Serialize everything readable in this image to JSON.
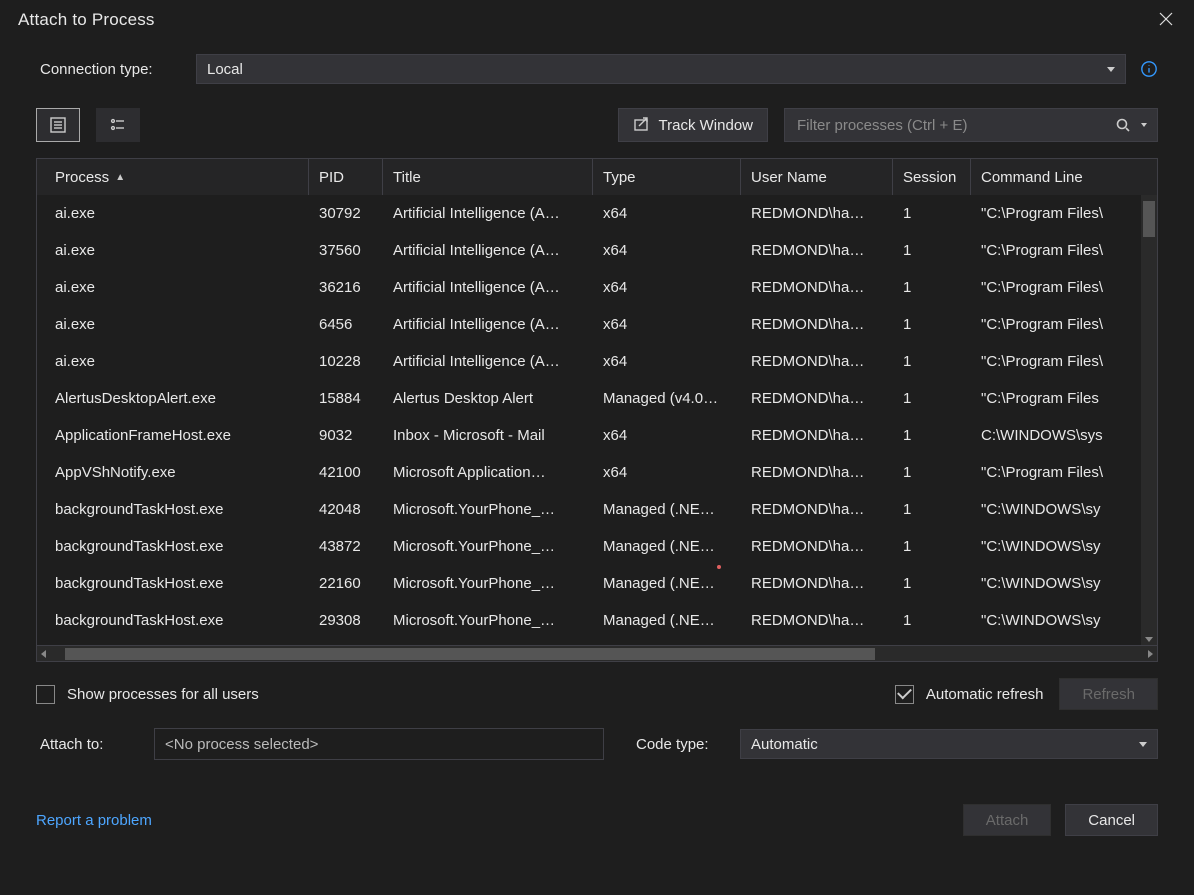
{
  "dialog": {
    "title": "Attach to Process"
  },
  "connection": {
    "label": "Connection type:",
    "value": "Local"
  },
  "toolbar": {
    "track_window_label": "Track Window",
    "filter_placeholder": "Filter processes (Ctrl + E)"
  },
  "columns": {
    "process": "Process",
    "pid": "PID",
    "title": "Title",
    "type": "Type",
    "user": "User Name",
    "session": "Session",
    "cmd": "Command Line"
  },
  "processes": [
    {
      "name": "ai.exe",
      "pid": "30792",
      "title": "Artificial Intelligence (A…",
      "type": "x64",
      "user": "REDMOND\\ha…",
      "session": "1",
      "cmd": "\"C:\\Program Files\\"
    },
    {
      "name": "ai.exe",
      "pid": "37560",
      "title": "Artificial Intelligence (A…",
      "type": "x64",
      "user": "REDMOND\\ha…",
      "session": "1",
      "cmd": "\"C:\\Program Files\\"
    },
    {
      "name": "ai.exe",
      "pid": "36216",
      "title": "Artificial Intelligence (A…",
      "type": "x64",
      "user": "REDMOND\\ha…",
      "session": "1",
      "cmd": "\"C:\\Program Files\\"
    },
    {
      "name": "ai.exe",
      "pid": "6456",
      "title": "Artificial Intelligence (A…",
      "type": "x64",
      "user": "REDMOND\\ha…",
      "session": "1",
      "cmd": "\"C:\\Program Files\\"
    },
    {
      "name": "ai.exe",
      "pid": "10228",
      "title": "Artificial Intelligence (A…",
      "type": "x64",
      "user": "REDMOND\\ha…",
      "session": "1",
      "cmd": "\"C:\\Program Files\\"
    },
    {
      "name": "AlertusDesktopAlert.exe",
      "pid": "15884",
      "title": "Alertus Desktop Alert",
      "type": "Managed (v4.0…",
      "user": "REDMOND\\ha…",
      "session": "1",
      "cmd": "\"C:\\Program Files"
    },
    {
      "name": "ApplicationFrameHost.exe",
      "pid": "9032",
      "title": "Inbox - Microsoft - Mail",
      "type": "x64",
      "user": "REDMOND\\ha…",
      "session": "1",
      "cmd": "C:\\WINDOWS\\sys"
    },
    {
      "name": "AppVShNotify.exe",
      "pid": "42100",
      "title": "Microsoft Application…",
      "type": "x64",
      "user": "REDMOND\\ha…",
      "session": "1",
      "cmd": "\"C:\\Program Files\\"
    },
    {
      "name": "backgroundTaskHost.exe",
      "pid": "42048",
      "title": "Microsoft.YourPhone_…",
      "type": "Managed (.NE…",
      "user": "REDMOND\\ha…",
      "session": "1",
      "cmd": "\"C:\\WINDOWS\\sy"
    },
    {
      "name": "backgroundTaskHost.exe",
      "pid": "43872",
      "title": "Microsoft.YourPhone_…",
      "type": "Managed (.NE…",
      "user": "REDMOND\\ha…",
      "session": "1",
      "cmd": "\"C:\\WINDOWS\\sy"
    },
    {
      "name": "backgroundTaskHost.exe",
      "pid": "22160",
      "title": "Microsoft.YourPhone_…",
      "type": "Managed (.NE…",
      "user": "REDMOND\\ha…",
      "session": "1",
      "cmd": "\"C:\\WINDOWS\\sy"
    },
    {
      "name": "backgroundTaskHost.exe",
      "pid": "29308",
      "title": "Microsoft.YourPhone_…",
      "type": "Managed (.NE…",
      "user": "REDMOND\\ha…",
      "session": "1",
      "cmd": "\"C:\\WINDOWS\\sy"
    }
  ],
  "options": {
    "show_all_users_label": "Show processes for all users",
    "show_all_users_checked": false,
    "auto_refresh_label": "Automatic refresh",
    "auto_refresh_checked": true,
    "refresh_label": "Refresh"
  },
  "attach": {
    "label": "Attach to:",
    "value": "<No process selected>",
    "code_type_label": "Code type:",
    "code_type_value": "Automatic"
  },
  "footer": {
    "report_link": "Report a problem",
    "attach_btn": "Attach",
    "cancel_btn": "Cancel"
  }
}
